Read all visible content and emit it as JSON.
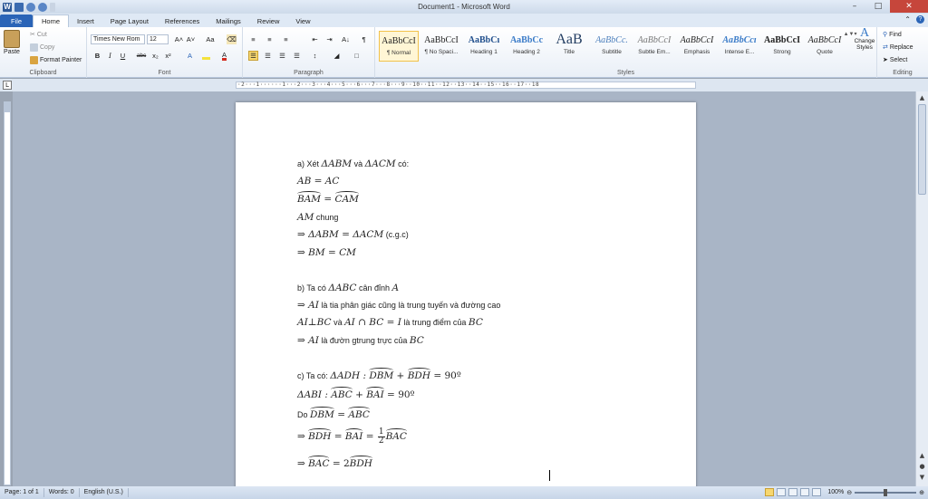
{
  "window": {
    "title": "Document1 - Microsoft Word",
    "app_icon": "W"
  },
  "tabs": [
    "File",
    "Home",
    "Insert",
    "Page Layout",
    "References",
    "Mailings",
    "Review",
    "View"
  ],
  "active_tab": "Home",
  "ribbon": {
    "clipboard": {
      "label": "Clipboard",
      "paste": "Paste",
      "cut": "Cut",
      "copy": "Copy",
      "format_painter": "Format Painter"
    },
    "font": {
      "label": "Font",
      "font_name": "Times New Rom",
      "font_size": "12",
      "grow": "A˄",
      "shrink": "A˅",
      "change_case": "Aa",
      "bold": "B",
      "italic": "I",
      "underline": "U",
      "strike": "abc",
      "subscript": "x₂",
      "superscript": "x²",
      "highlight_color": "#f4e23c",
      "font_color": "#d22a1f"
    },
    "paragraph": {
      "label": "Paragraph",
      "show_marks": "¶",
      "sort": "A↓"
    },
    "styles": {
      "label": "Styles",
      "items": [
        {
          "preview": "AaBbCcI",
          "name": "¶ Normal"
        },
        {
          "preview": "AaBbCcI",
          "name": "¶ No Spaci..."
        },
        {
          "preview": "AaBbCı",
          "name": "Heading 1"
        },
        {
          "preview": "AaBbCc",
          "name": "Heading 2"
        },
        {
          "preview": "AaB",
          "name": "Title"
        },
        {
          "preview": "AaBbCc.",
          "name": "Subtitle"
        },
        {
          "preview": "AaBbCcI",
          "name": "Subtle Em..."
        },
        {
          "preview": "AaBbCcI",
          "name": "Emphasis"
        },
        {
          "preview": "AaBbCcı",
          "name": "Intense E..."
        },
        {
          "preview": "AaBbCcI",
          "name": "Strong"
        },
        {
          "preview": "AaBbCcI",
          "name": "Quote"
        }
      ],
      "change_styles": "Change Styles"
    },
    "editing": {
      "label": "Editing",
      "find": "Find",
      "replace": "Replace",
      "select": "Select"
    }
  },
  "ruler": {
    "numbers": "·2···1······1···2···3···4···5···6···7···8···9··10··11··12··13··14··15··16··17··18"
  },
  "document": {
    "part_a": {
      "l1_text": "a) Xét ",
      "l1_t1": "ΔABM",
      "l1_and": " và ",
      "l1_t2": "ΔACM",
      "l1_end": " có:",
      "l2": "AB = AC",
      "l3_a1": "BAM",
      "l3_eq": " = ",
      "l3_a2": "CAM",
      "l4_m": "AM",
      "l4_t": " chung",
      "l5_arrow": "⇒ ",
      "l5_m": "ΔABM = ΔACM",
      "l5_t": " (c.g.c)",
      "l6_arrow": "⇒ ",
      "l6_m": "BM = CM"
    },
    "part_b": {
      "l1_text": "b) Ta có ",
      "l1_m": "ΔABC",
      "l1_mid": " cân đỉnh ",
      "l1_m2": "A",
      "l2_arrow": "⇒ ",
      "l2_m": "AI",
      "l2_t": " là tia phân giác cũng là trung tuyến và đường cao",
      "l3_m1": "AI⊥BC",
      "l3_and": " và ",
      "l3_m2": "AI ∩ BC = I",
      "l3_mid": " là trung điểm của ",
      "l3_m3": "BC",
      "l4_arrow": "⇒ ",
      "l4_m": "AI",
      "l4_mid": " là đườn gtrung trực của ",
      "l4_m2": "BC"
    },
    "part_c": {
      "l1_text": "c) Ta có: ",
      "l1_m": "ΔADH : ",
      "l1_a1": "DBM",
      "l1_plus": " + ",
      "l1_a2": "BDH",
      "l1_eq": " = 90º",
      "l2_m": "ΔABI : ",
      "l2_a1": "ABC",
      "l2_plus": " + ",
      "l2_a2": "BAI",
      "l2_eq": " = 90º",
      "l3_text": "Do ",
      "l3_a1": "DBM",
      "l3_eq": " = ",
      "l3_a2": "ABC",
      "l4_arrow": "⇒ ",
      "l4_a1": "BDH",
      "l4_eq": " = ",
      "l4_a2": "BAI",
      "l4_eq2": " = ",
      "l4_num": "1",
      "l4_den": "2",
      "l4_a3": "BAC",
      "l5_arrow": "⇒ ",
      "l5_a1": "BAC",
      "l5_eq": " = 2",
      "l5_a2": "BDH"
    }
  },
  "status": {
    "page": "Page: 1 of 1",
    "words": "Words: 0",
    "language": "English (U.S.)",
    "zoom": "100%"
  }
}
